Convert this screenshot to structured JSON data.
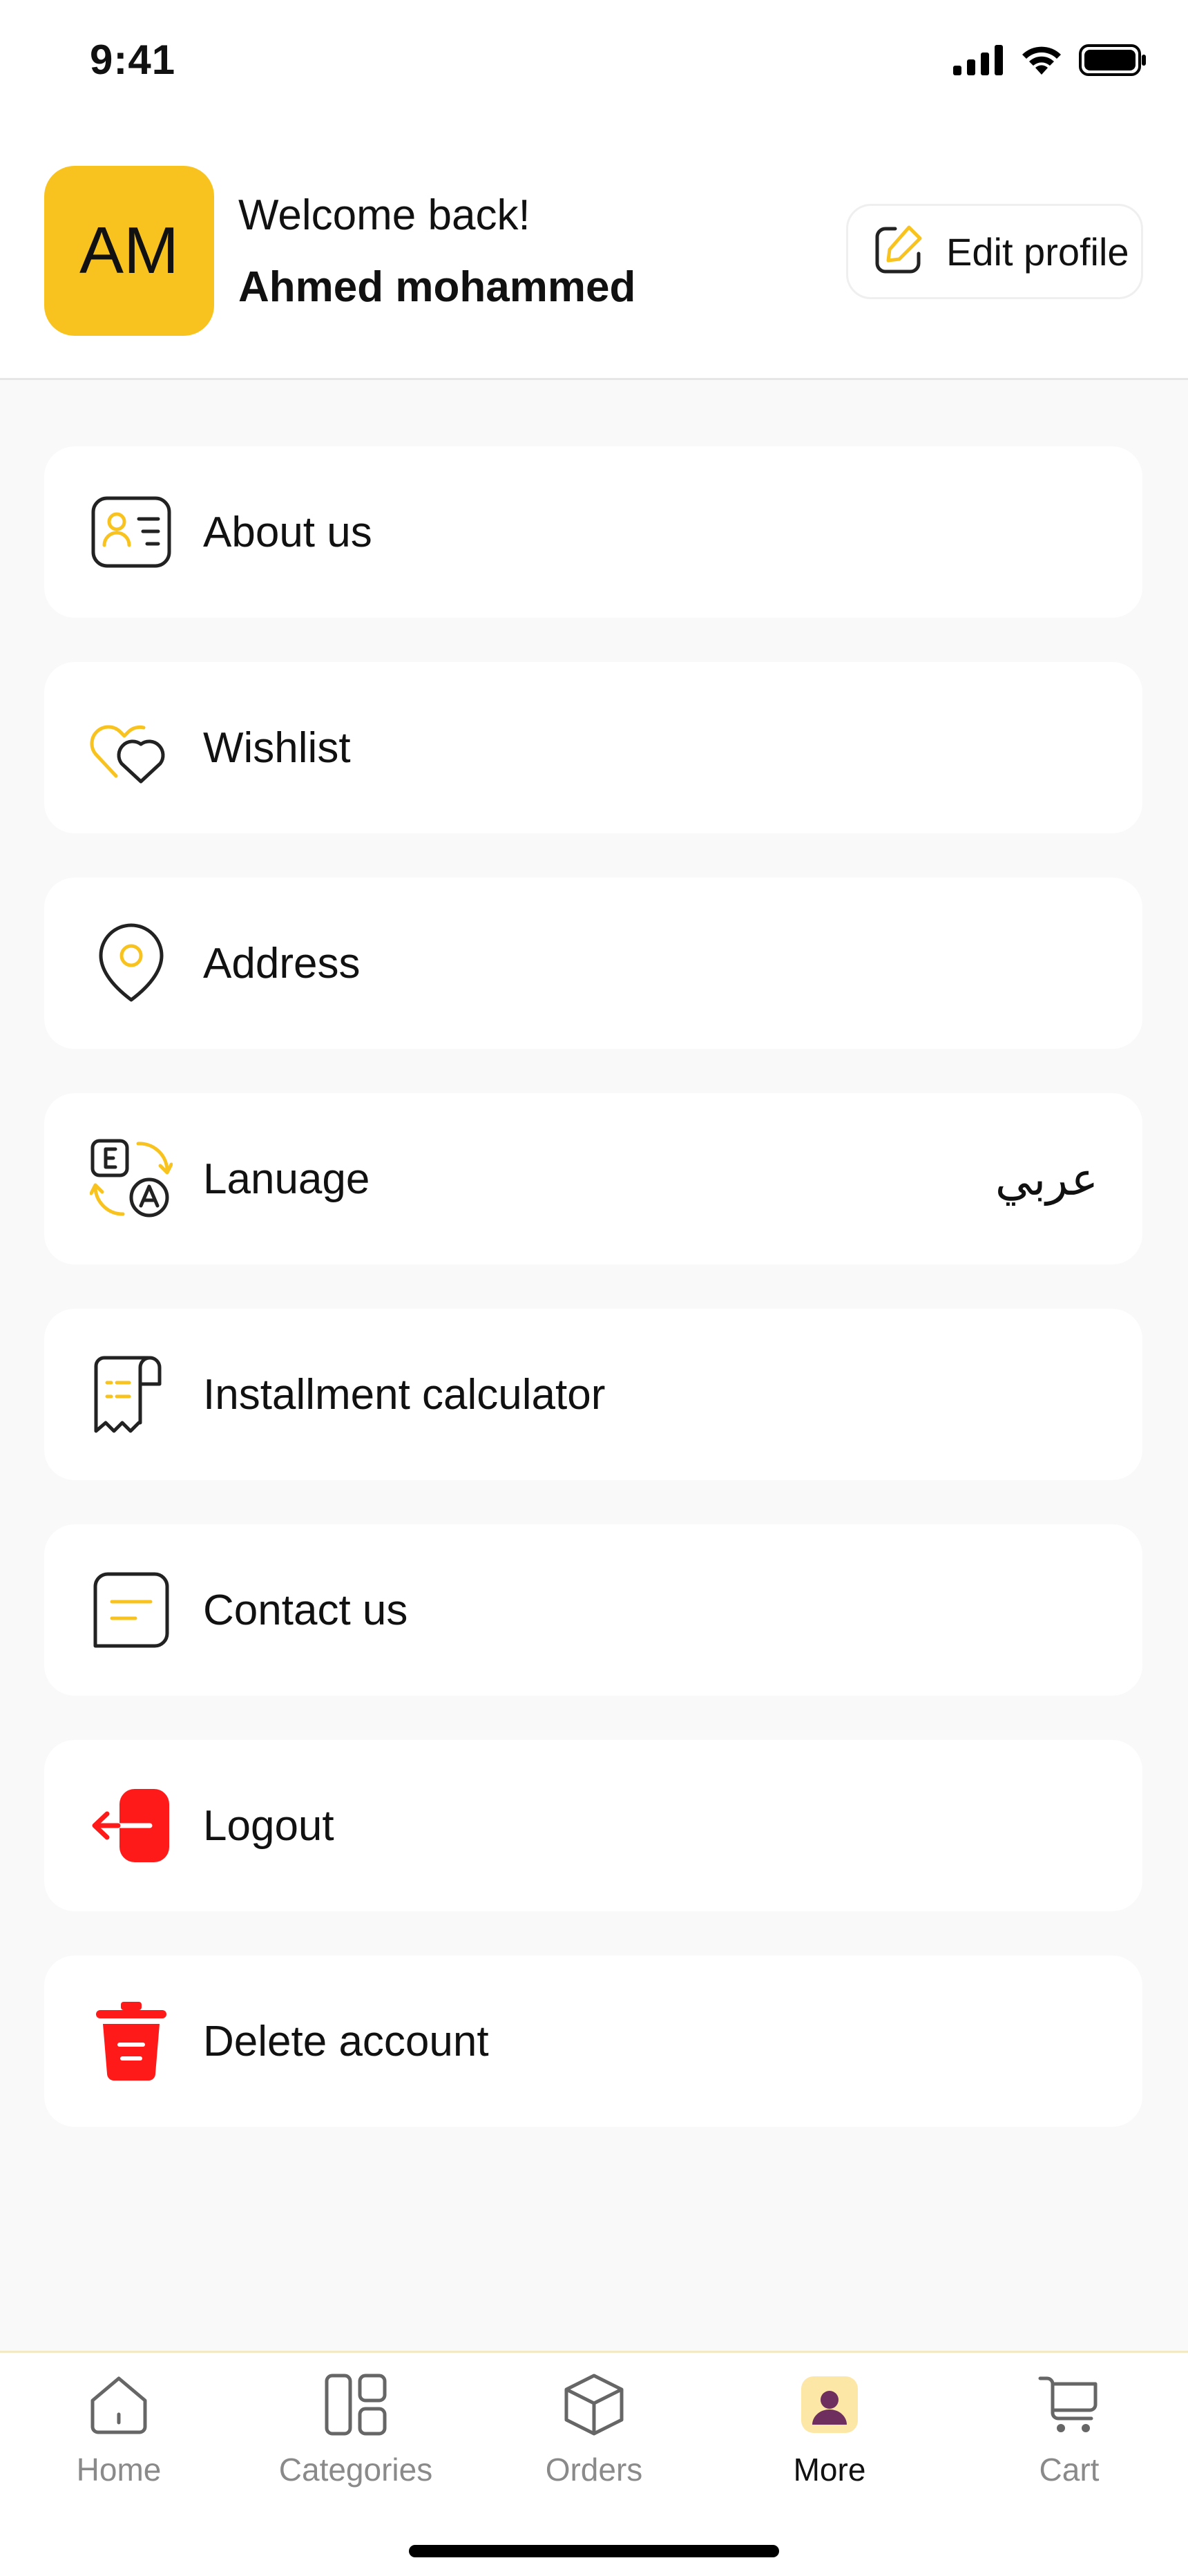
{
  "status_bar": {
    "time": "9:41",
    "icons": [
      "signal-icon",
      "wifi-icon",
      "battery-icon"
    ]
  },
  "header": {
    "avatar_initials": "AM",
    "welcome": "Welcome back!",
    "username": "Ahmed mohammed",
    "edit_label": "Edit profile",
    "edit_icon": "edit-icon"
  },
  "menu": {
    "items": [
      {
        "label": "About us",
        "icon": "id-card-icon"
      },
      {
        "label": "Wishlist",
        "icon": "heart-icon"
      },
      {
        "label": "Address",
        "icon": "location-pin-icon"
      },
      {
        "label": "Lanuage",
        "icon": "translate-icon",
        "value": "عربي"
      },
      {
        "label": "Installment calculator",
        "icon": "receipt-icon"
      },
      {
        "label": "Contact us",
        "icon": "message-icon"
      },
      {
        "label": "Logout",
        "icon": "logout-icon"
      },
      {
        "label": "Delete account",
        "icon": "trash-icon"
      }
    ]
  },
  "tabs": {
    "items": [
      {
        "label": "Home",
        "icon": "home-icon"
      },
      {
        "label": "Categories",
        "icon": "categories-icon"
      },
      {
        "label": "Orders",
        "icon": "box-icon"
      },
      {
        "label": "More",
        "icon": "profile-icon",
        "active": true
      },
      {
        "label": "Cart",
        "icon": "cart-icon"
      }
    ]
  },
  "colors": {
    "accent": "#f9c31f",
    "danger": "#ff1a1a",
    "background": "#f9f9f9"
  }
}
